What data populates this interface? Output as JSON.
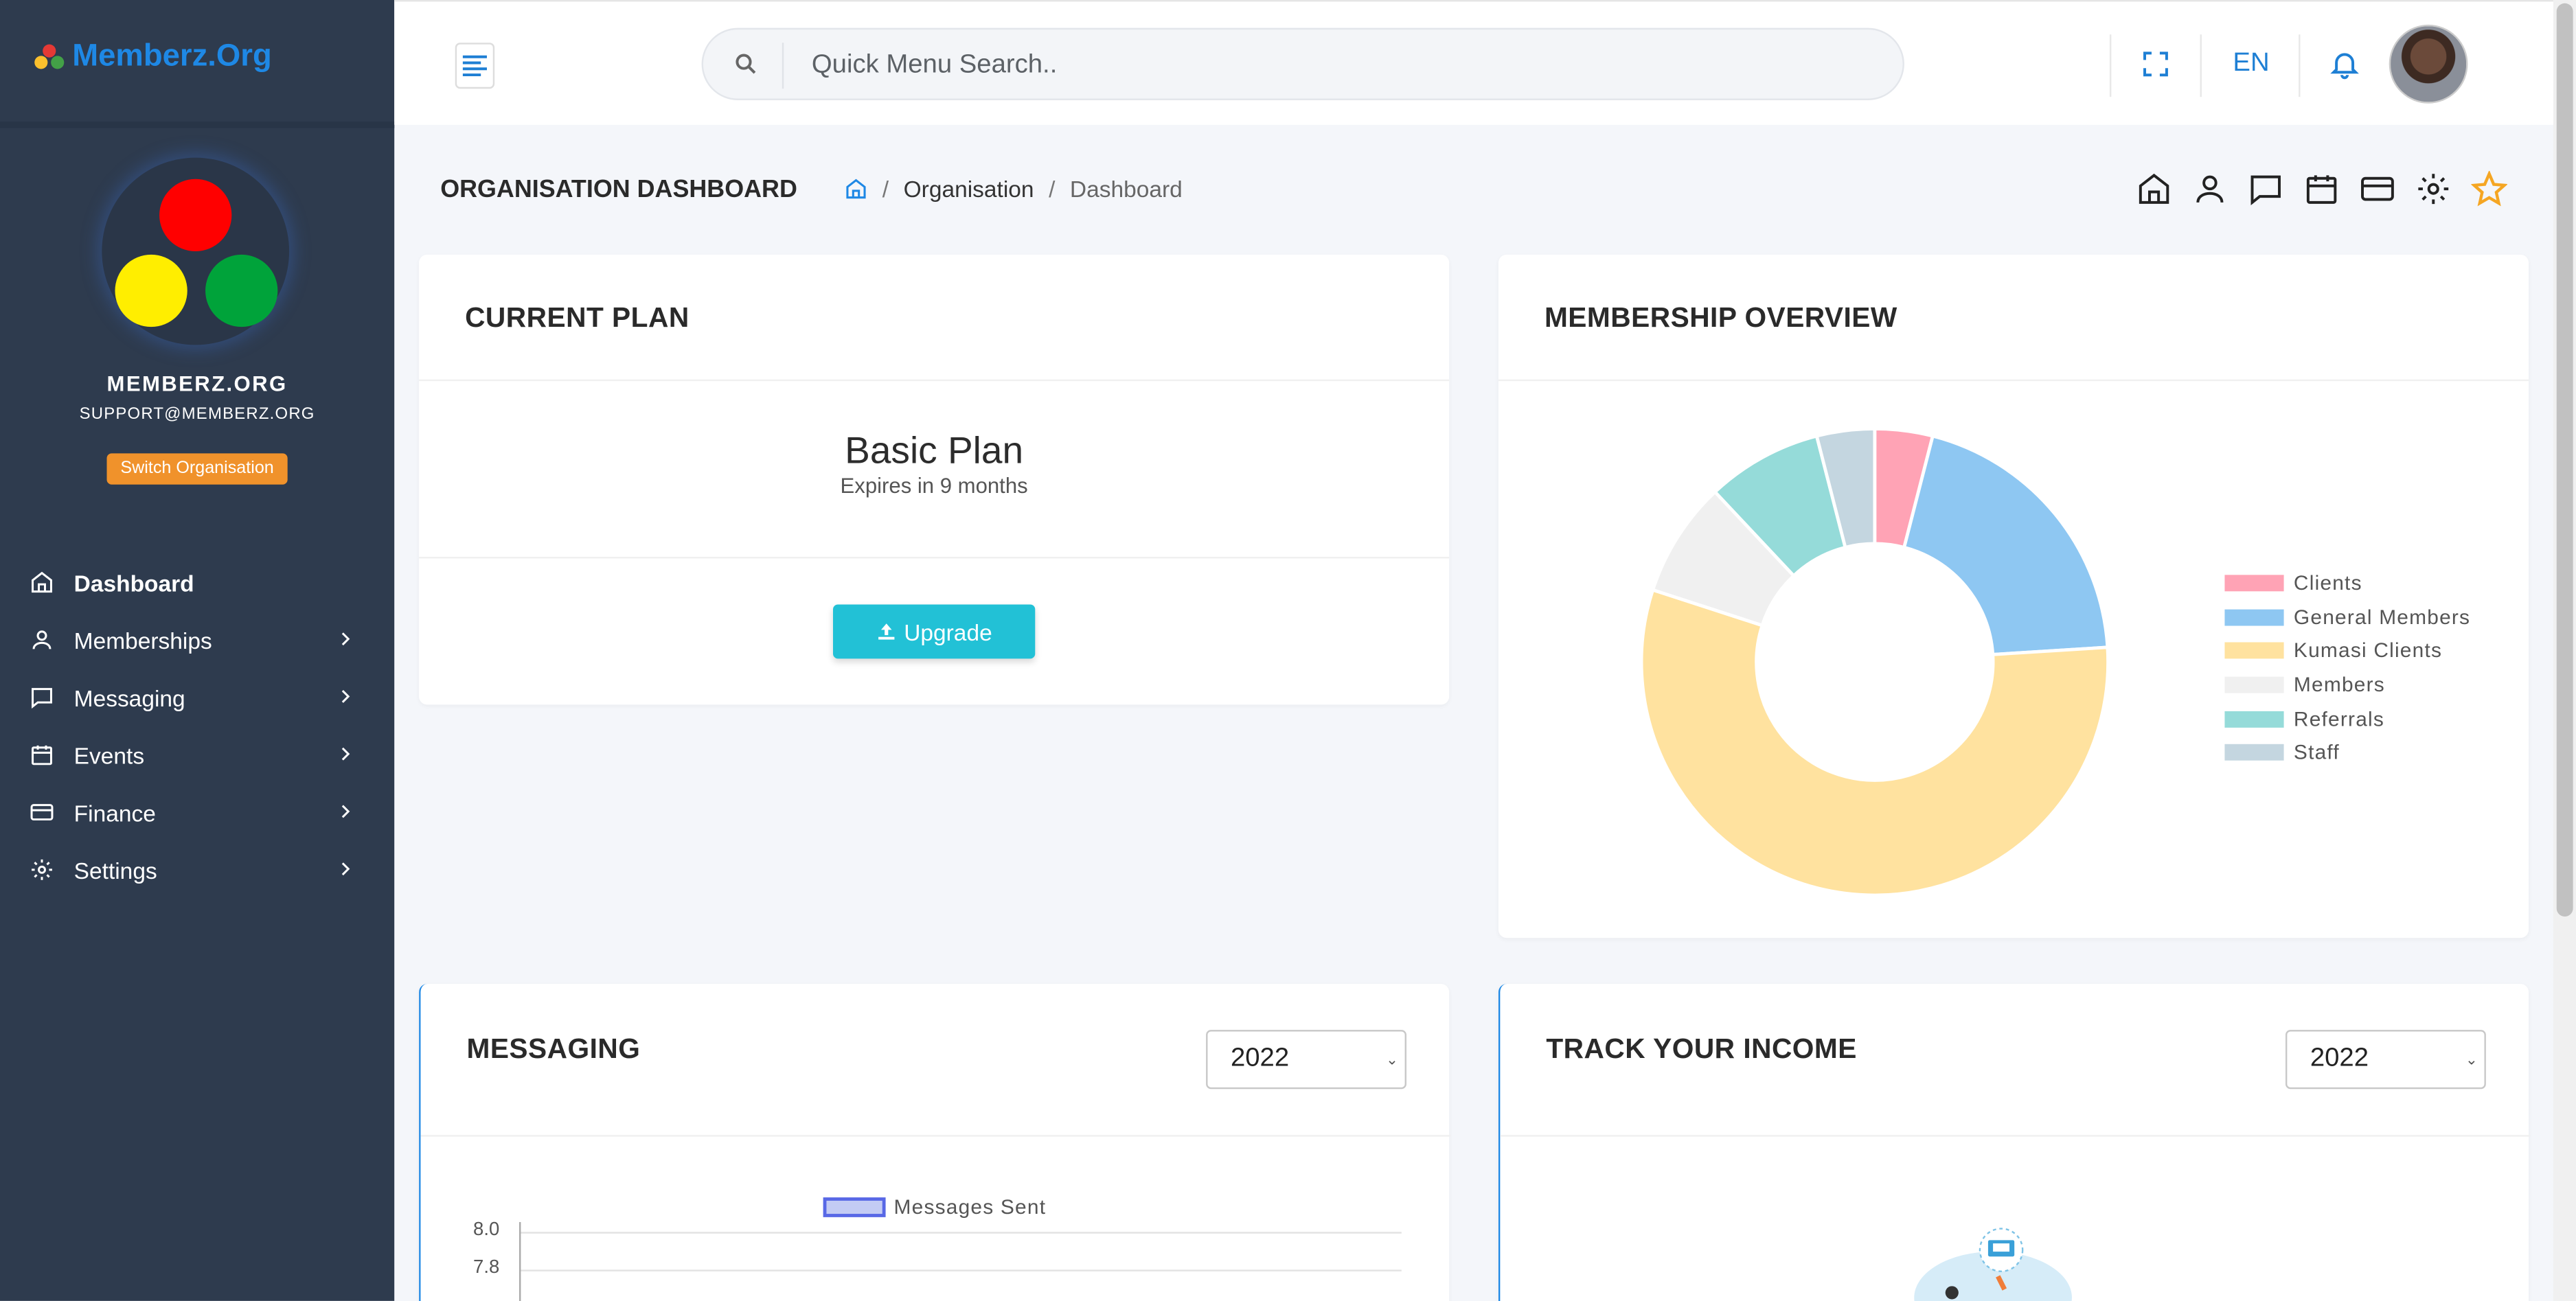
{
  "brand": {
    "name": "Memberz.Org"
  },
  "org": {
    "name": "MEMBERZ.ORG",
    "email": "SUPPORT@MEMBERZ.ORG",
    "switch_label": "Switch Organisation"
  },
  "nav": [
    {
      "label": "Dashboard",
      "icon": "home-icon",
      "active": true
    },
    {
      "label": "Memberships",
      "icon": "user-icon"
    },
    {
      "label": "Messaging",
      "icon": "message-icon"
    },
    {
      "label": "Events",
      "icon": "calendar-icon"
    },
    {
      "label": "Finance",
      "icon": "card-icon"
    },
    {
      "label": "Settings",
      "icon": "gear-icon"
    }
  ],
  "topbar": {
    "search_placeholder": "Quick Menu Search..",
    "language": "EN"
  },
  "page": {
    "title": "ORGANISATION DASHBOARD",
    "breadcrumb": [
      "Organisation",
      "Dashboard"
    ]
  },
  "current_plan": {
    "title": "CURRENT PLAN",
    "plan_name": "Basic Plan",
    "expires": "Expires in 9 months",
    "upgrade_label": "Upgrade"
  },
  "membership_overview": {
    "title": "MEMBERSHIP OVERVIEW"
  },
  "messaging": {
    "title": "MESSAGING",
    "year": "2022",
    "legend": "Messages Sent",
    "y_ticks": [
      "8.0",
      "7.8"
    ]
  },
  "income": {
    "title": "TRACK YOUR INCOME",
    "year": "2022"
  },
  "colors": {
    "sidebar": "#2e3b4e",
    "accent": "#22c1d6",
    "switch": "#f0922b",
    "star": "#f5a623"
  },
  "chart_data": {
    "type": "pie",
    "title": "",
    "labels": [
      "Clients",
      "General Members",
      "Kumasi Clients",
      "Members",
      "Referrals",
      "Staff"
    ],
    "values": [
      4,
      20,
      56,
      8,
      8,
      4
    ],
    "colors": [
      "#ffa3b5",
      "#8ec7f2",
      "#ffe29f",
      "#f0f0f0",
      "#95dbd9",
      "#c4d6e0"
    ],
    "legend_position": "right"
  }
}
